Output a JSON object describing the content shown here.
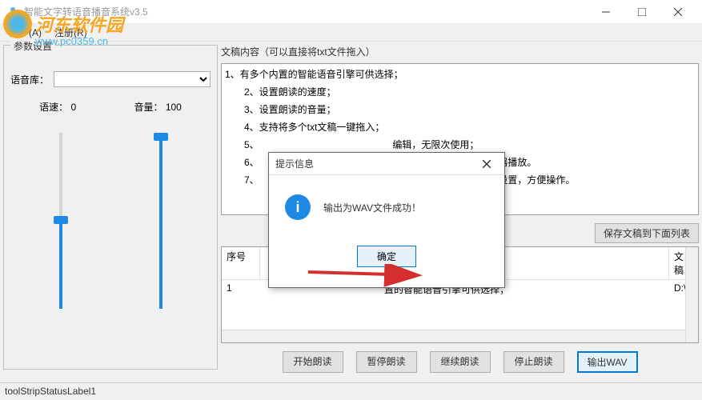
{
  "window": {
    "title": "智能文字转语音播音系统v3.5"
  },
  "menu": {
    "about": "关于(A)",
    "register": "注册(R)"
  },
  "watermark": {
    "line1": "河东软件园",
    "line2": "www.pc0359.cn"
  },
  "params": {
    "legend": "参数设置",
    "voice_lib_label": "语音库：",
    "speed_label": "语速：",
    "speed_value": "0",
    "volume_label": "音量：",
    "volume_value": "100"
  },
  "content": {
    "label": "文稿内容（可以直接将txt文件拖入）",
    "lines": [
      "1、有多个内置的智能语音引擎可供选择；",
      "2、设置朗读的速度；",
      "3、设置朗读的音量；",
      "4、支持将多个txt文稿一键拖入；",
      "5、",
      "6、",
      "7、"
    ],
    "partial5": "编辑，无限次使用；",
    "partial6": "以使用市面上的音乐播放器播放。",
    "partial7": "恢复设置信息，无需再次设置，方便操作。",
    "save_btn": "保存文稿到下面列表"
  },
  "list": {
    "col_seq": "序号",
    "col_file": "文稿",
    "row1_seq": "1",
    "row1_text": "置的智能语音引擎可供选择；",
    "row1_file": "D:\\"
  },
  "buttons": {
    "start": "开始朗读",
    "pause": "暂停朗读",
    "resume": "继续朗读",
    "stop": "停止朗读",
    "export": "输出WAV"
  },
  "status": "toolStripStatusLabel1",
  "dialog": {
    "title": "提示信息",
    "message": "输出为WAV文件成功！",
    "ok": "确定"
  }
}
